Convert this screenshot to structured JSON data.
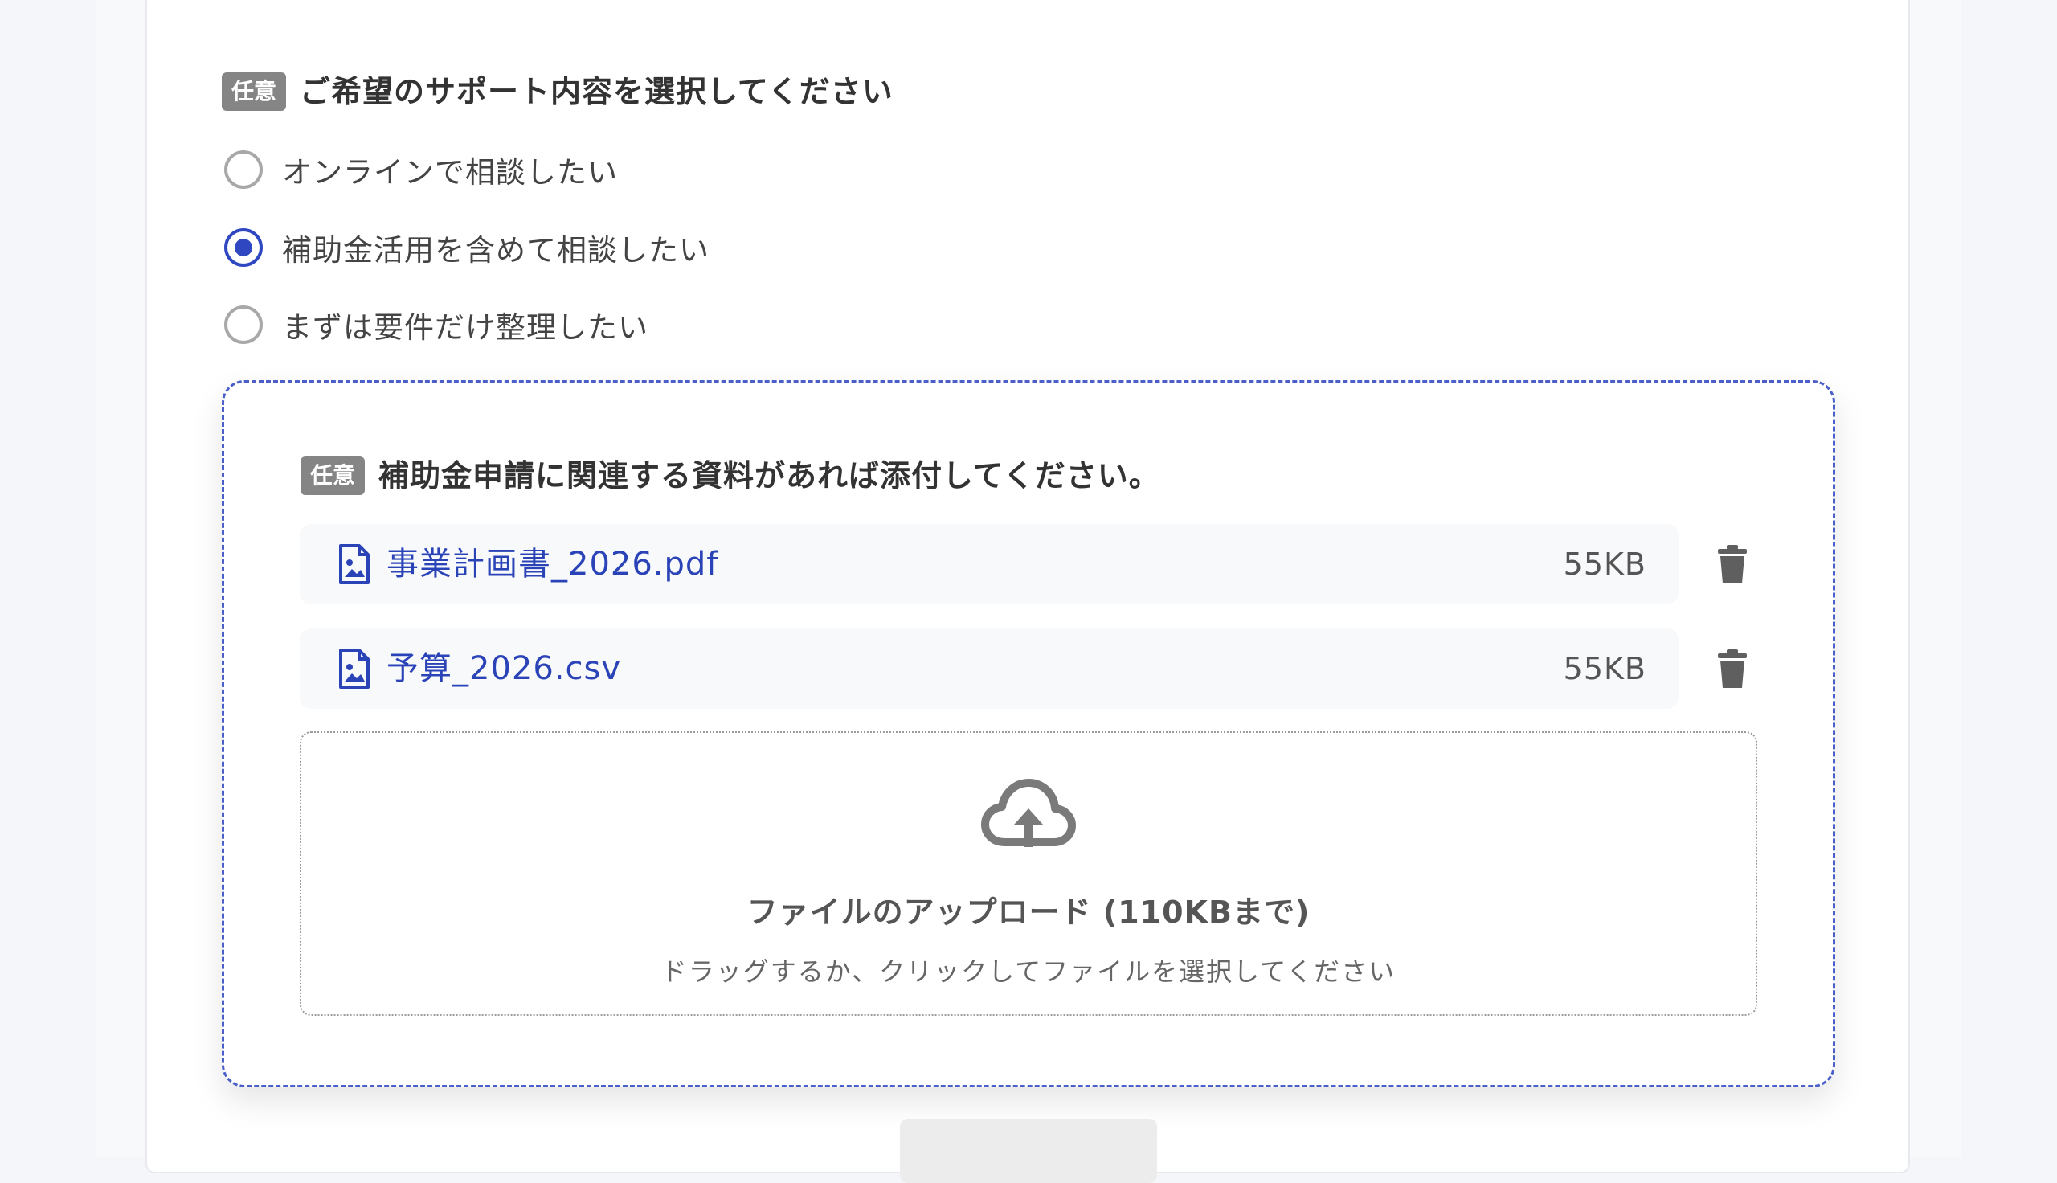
{
  "support_question": {
    "badge": "任意",
    "title": "ご希望のサポート内容を選択してください",
    "options": [
      {
        "label": "オンラインで相談したい",
        "checked": false
      },
      {
        "label": "補助金活用を含めて相談したい",
        "checked": true
      },
      {
        "label": "まずは要件だけ整理したい",
        "checked": false
      }
    ]
  },
  "attachments": {
    "badge": "任意",
    "title": "補助金申請に関連する資料があれば添付してください。",
    "files": [
      {
        "name": "事業計画書_2026.pdf",
        "size": "55KB"
      },
      {
        "name": "予算_2026.csv",
        "size": "55KB"
      }
    ],
    "dropzone": {
      "title": "ファイルのアップロード (110KBまで)",
      "subtitle": "ドラッグするか、クリックしてファイルを選択してください"
    }
  },
  "colors": {
    "accent": "#2f47c0",
    "link": "#2a44b8",
    "badge_bg": "#858585"
  },
  "icons": {
    "file": "file-image-icon",
    "delete": "trash-icon",
    "upload": "cloud-upload-icon"
  }
}
